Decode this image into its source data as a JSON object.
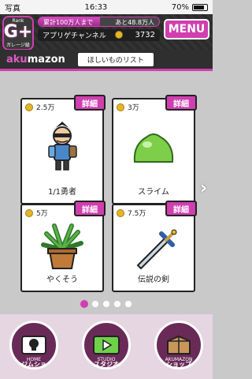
{
  "status": {
    "left": "写真",
    "time": "16:33",
    "battery": "70%"
  },
  "header": {
    "rank_label": "Rank",
    "rank_letter": "G+",
    "rank_sub": "ガレージ級",
    "progress_left": "累計100万人まで",
    "progress_right": "あと48.8万人",
    "progress_fraction": 0.512,
    "channel_name": "アプリゲチャンネル",
    "coins": "3732",
    "menu_label": "MENU"
  },
  "akumazon": {
    "logo_prefix": "aku",
    "logo_suffix": "mazon",
    "wishlist": "ほしいものリスト"
  },
  "items": [
    {
      "price": "2.5万",
      "detail": "詳細",
      "name": "1/1勇者",
      "icon": "hero-icon"
    },
    {
      "price": "3万",
      "detail": "詳細",
      "name": "スライム",
      "icon": "slime-icon"
    },
    {
      "price": "5万",
      "detail": "詳細",
      "name": "やくそう",
      "icon": "herb-icon"
    },
    {
      "price": "7.5万",
      "detail": "詳細",
      "name": "伝説の剣",
      "icon": "sword-icon"
    }
  ],
  "pagination": {
    "current": 1,
    "total": 5
  },
  "nav": [
    {
      "label": "ジムショ",
      "sub": "HOME"
    },
    {
      "label": "スタジオ",
      "sub": "STUDIO"
    },
    {
      "label": "ショップ",
      "sub": "AKUMAZON"
    }
  ],
  "colors": {
    "accent": "#d03fb0",
    "header_bg": "#2b2b2b",
    "coin": "#e4b72b"
  }
}
